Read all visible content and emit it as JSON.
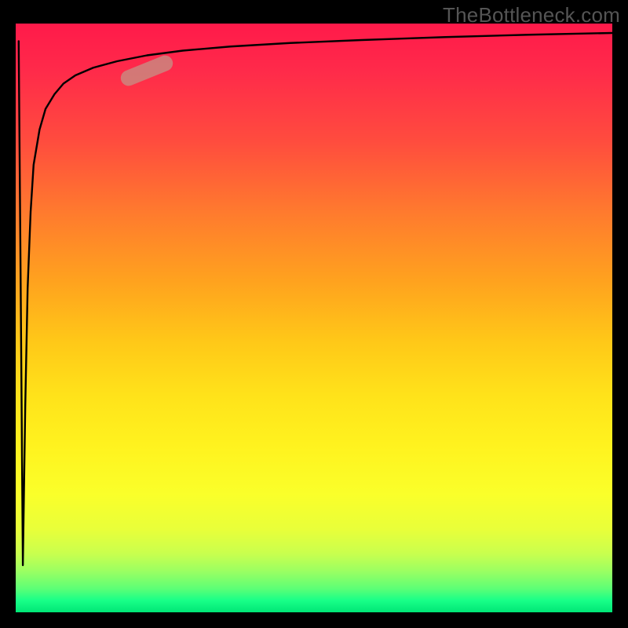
{
  "watermark": "TheBottleneck.com",
  "colors": {
    "frame": "#000000",
    "gradient_top": "#ff1a4a",
    "gradient_bottom": "#00e676",
    "curve": "#000000",
    "marker": "rgba(200,140,130,0.80)"
  },
  "chart_data": {
    "type": "line",
    "title": "",
    "xlabel": "",
    "ylabel": "",
    "xlim": [
      0,
      100
    ],
    "ylim": [
      0,
      100
    ],
    "grid": false,
    "legend": false,
    "note": "Axes are unlabeled; values are estimated from pixel positions on a 0-100 normalized scale. The curve starts near the top-left, plunges almost vertically to the bottom, then rises steeply and asymptotically approaches the top edge moving right (log-like shape after the dip).",
    "series": [
      {
        "name": "curve",
        "x": [
          0.5,
          0.8,
          1.2,
          1.6,
          2.0,
          2.5,
          3.0,
          4.0,
          5.0,
          6.5,
          8.0,
          10.0,
          13.0,
          17.0,
          22.0,
          28.0,
          36.0,
          46.0,
          58.0,
          72.0,
          86.0,
          100.0
        ],
        "y": [
          97.0,
          60.0,
          8.0,
          35.0,
          55.0,
          68.0,
          76.0,
          82.0,
          85.5,
          88.0,
          89.8,
          91.2,
          92.5,
          93.6,
          94.6,
          95.4,
          96.1,
          96.7,
          97.2,
          97.7,
          98.1,
          98.4
        ]
      }
    ],
    "marker": {
      "name": "highlight-pill",
      "x": 22.0,
      "y": 92.0,
      "angle_deg": -22
    },
    "background_gradient": {
      "orientation": "vertical",
      "stops": [
        {
          "pos": 0.0,
          "color": "#ff1a4a"
        },
        {
          "pos": 0.5,
          "color": "#ffc818"
        },
        {
          "pos": 0.8,
          "color": "#faff2a"
        },
        {
          "pos": 1.0,
          "color": "#00e676"
        }
      ]
    }
  }
}
